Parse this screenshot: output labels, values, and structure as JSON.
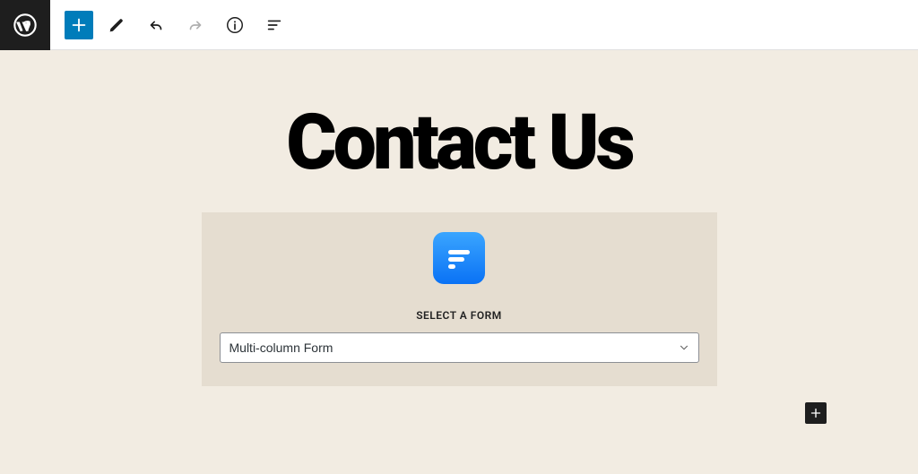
{
  "toolbar": {
    "icons": {
      "wp": "wordpress-icon",
      "add": "plus-icon",
      "edit": "pencil-icon",
      "undo": "undo-icon",
      "redo": "redo-icon",
      "info": "info-icon",
      "outline": "list-view-icon"
    }
  },
  "page": {
    "title": "Contact Us"
  },
  "formBlock": {
    "label": "SELECT A FORM",
    "selectedValue": "Multi-column Form",
    "options": [
      "Multi-column Form"
    ]
  },
  "colors": {
    "toolbarBg": "#ffffff",
    "canvasBg": "#f2ece2",
    "blockBg": "#e5ddd0",
    "primaryBlue": "#007cba",
    "dark": "#1e1e1e"
  }
}
